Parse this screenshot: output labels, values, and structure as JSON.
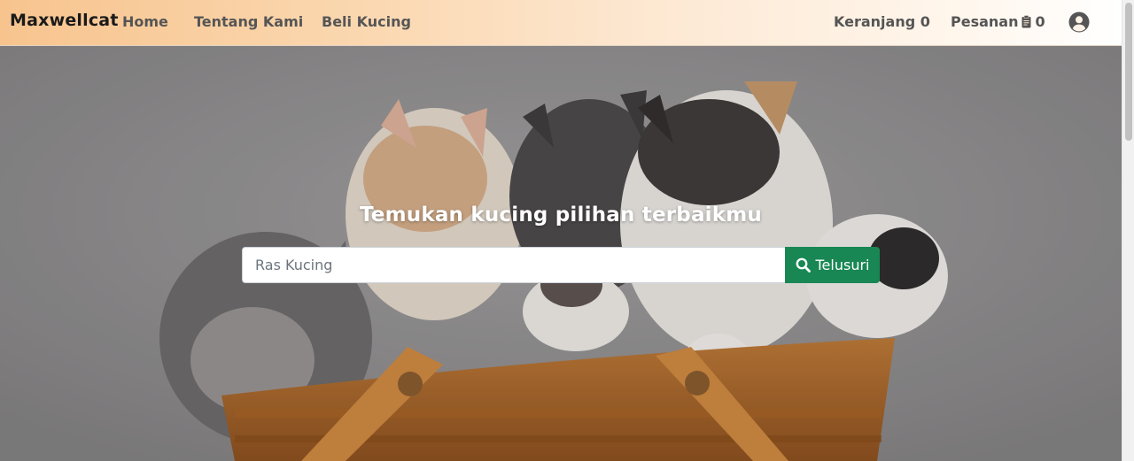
{
  "nav": {
    "brand": "Maxwellcat",
    "home": "Home",
    "about": "Tentang Kami",
    "buy": "Beli Kucing",
    "cart_label": "Keranjang 0",
    "orders_label": "Pesanan",
    "orders_count": "0"
  },
  "hero": {
    "title": "Temukan kucing pilihan terbaikmu",
    "search_placeholder": "Ras Kucing",
    "search_button": "Telusuri"
  },
  "colors": {
    "accent_green": "#198754",
    "nav_gradient_start": "#f7c48e"
  },
  "icons": [
    "clipboard-icon",
    "user-circle-icon",
    "search-icon"
  ]
}
